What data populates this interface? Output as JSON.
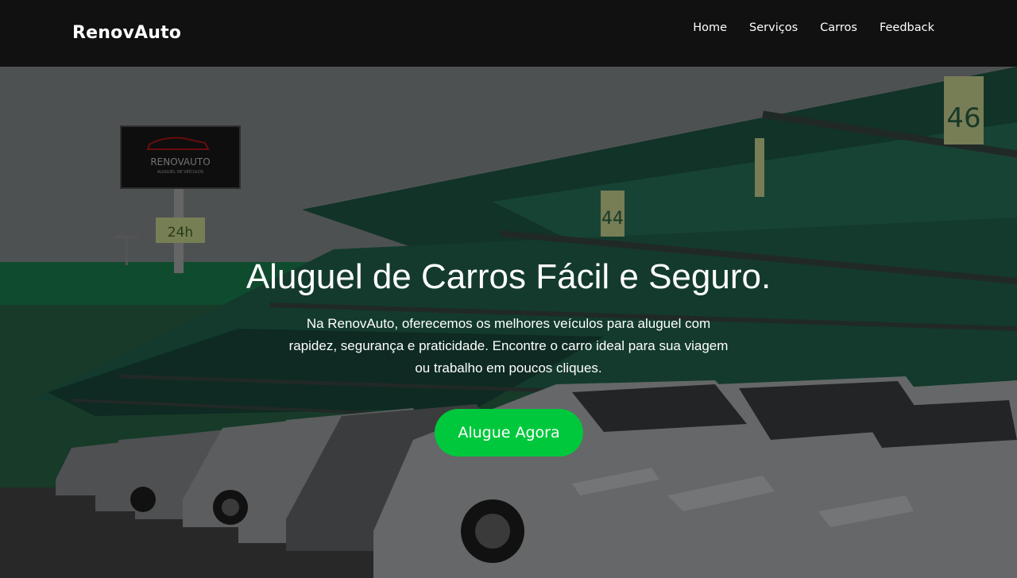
{
  "nav": {
    "brand": "RenovAuto",
    "links": [
      {
        "label": "Home"
      },
      {
        "label": "Serviços"
      },
      {
        "label": "Carros"
      },
      {
        "label": "Feedback"
      }
    ]
  },
  "hero": {
    "title": "Aluguel de Carros Fácil e Seguro.",
    "text": "Na RenovAuto, oferecemos os melhores veículos para aluguel com rapidez, segurança e praticidade. Encontre o carro ideal para sua viagem ou trabalho em poucos cliques.",
    "cta_label": "Alugue Agora"
  },
  "background": {
    "sign_brand": "RENOVAUTO",
    "sign_subtitle": "ALUGUEL DE VEÍCULOS",
    "sign_hours": "24h",
    "spot_numbers": [
      "46",
      "44"
    ]
  },
  "colors": {
    "navbar": "#111111",
    "cta": "#00c83c",
    "canopy": "#1f5d4a"
  }
}
